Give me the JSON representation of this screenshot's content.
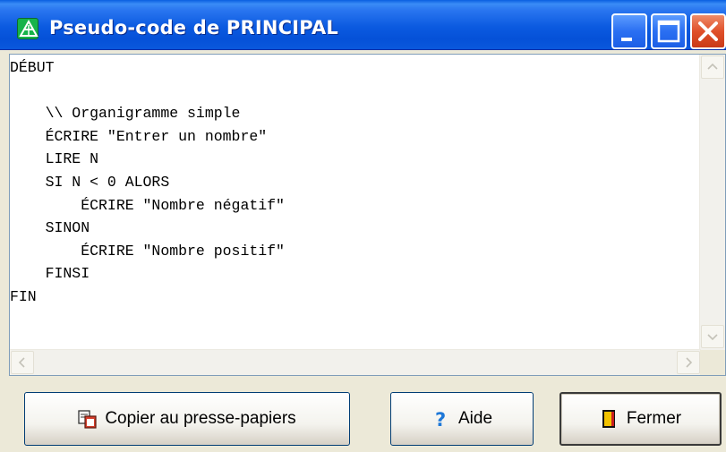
{
  "window": {
    "title": "Pseudo-code de PRINCIPAL",
    "controls": [
      "minimize-icon",
      "maximize-icon",
      "close-icon"
    ]
  },
  "editor": {
    "lines": [
      "DÉBUT",
      "",
      "    \\\\ Organigramme simple",
      "    ÉCRIRE \"Entrer un nombre\"",
      "    LIRE N",
      "    SI N < 0 ALORS",
      "        ÉCRIRE \"Nombre négatif\"",
      "    SINON",
      "        ÉCRIRE \"Nombre positif\"",
      "    FINSI",
      "FIN"
    ]
  },
  "buttons": {
    "copy_label": "Copier au presse-papiers",
    "help_label": "Aide",
    "close_label": "Fermer"
  },
  "colors": {
    "titlebar": "#0b5ae0",
    "close_button": "#e0502a",
    "help_icon": "#1e78d8"
  }
}
